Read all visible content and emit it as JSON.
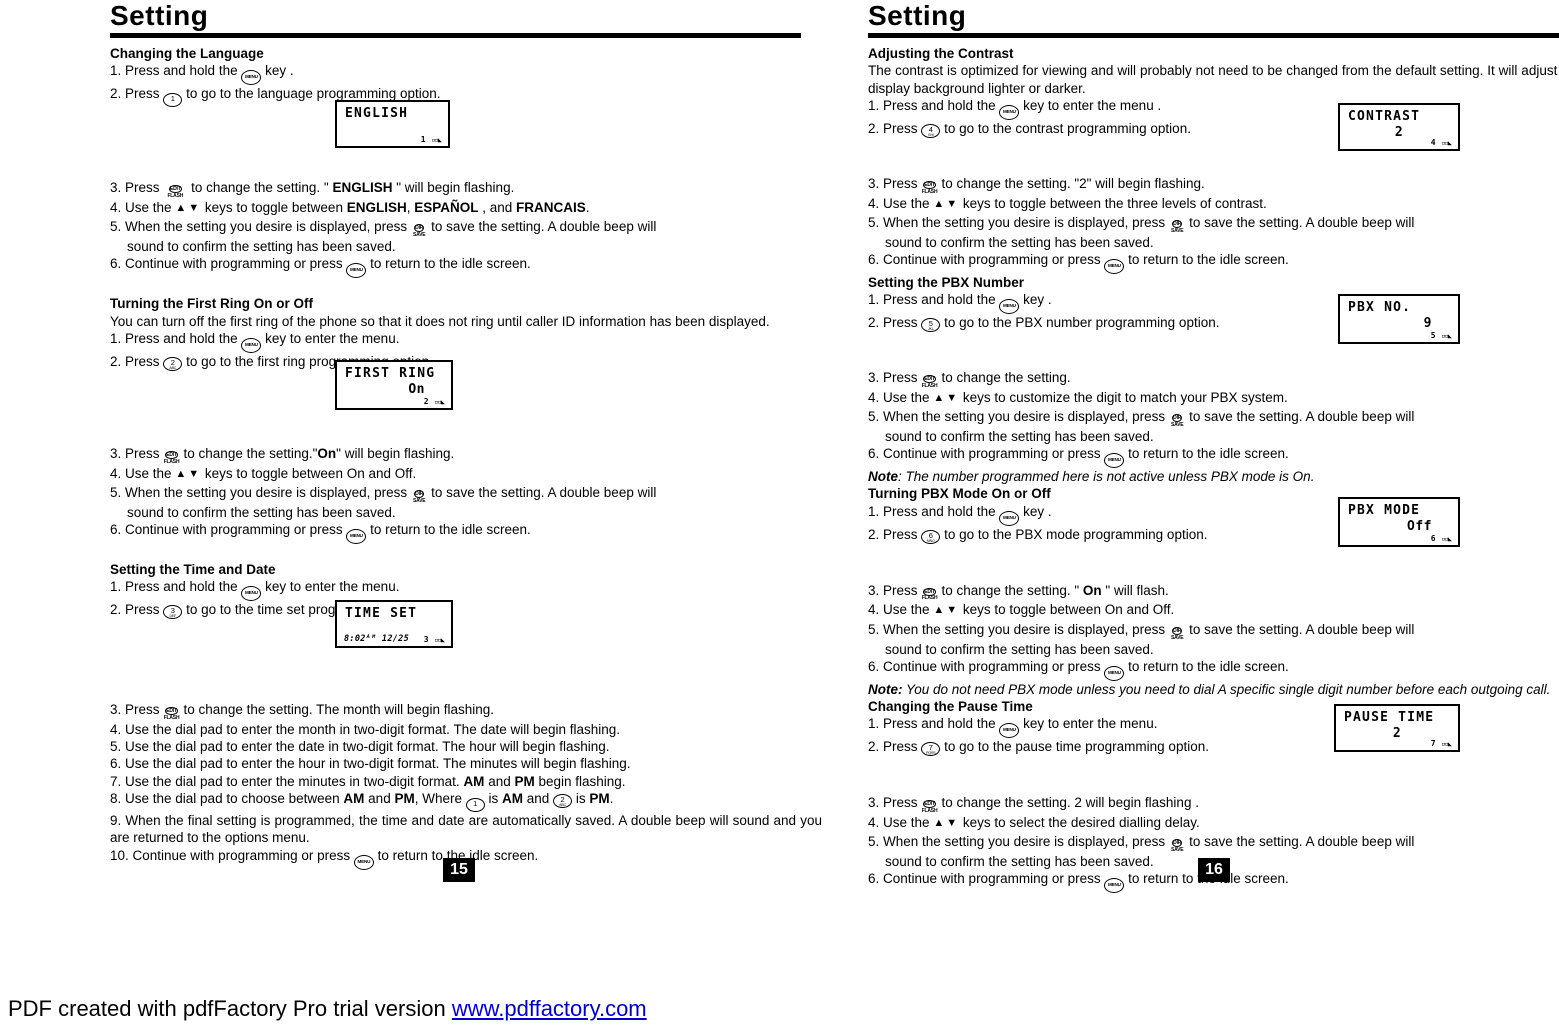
{
  "document": {
    "footer_text": "PDF created with pdfFactory Pro trial version ",
    "footer_link": "www.pdffactory.com"
  },
  "left_page": {
    "title": "Setting",
    "page_number": "15",
    "sections": [
      {
        "heading": "Changing the Language",
        "steps_before": [
          "1. Press and hold the",
          "2. Press"
        ],
        "step1_tail": "key .",
        "step2_tail": "to go to the language programming option.",
        "lcd": {
          "line1": "ENGLISH",
          "line2": "",
          "indicator": "1"
        },
        "steps_after": [
          {
            "num": "3. Press",
            "mid": "to change the setting. \" ",
            "bold": "ENGLISH",
            "tail": " \"  will begin flashing."
          },
          {
            "num": "4. Use the",
            "mid": "keys to toggle between ",
            "bold": "ENGLISH",
            "bold2": "ESPAÑOL",
            "bold3": "FRANCAIS",
            "tail": "."
          },
          {
            "num": "5. When the setting you desire is displayed, press",
            "tail": "to save the setting. A double beep will",
            "cont": "sound to confirm the setting has been saved."
          },
          {
            "num": "6. Continue with programming or press",
            "tail": "to return to the idle screen."
          }
        ]
      },
      {
        "heading": "Turning the First Ring On or Off",
        "intro": "You can turn off the first ring of the phone so that it does not ring until caller ID information has been displayed.",
        "step1": "1. Press and hold the",
        "step1_tail": "key to enter the menu.",
        "step2": "2. Press",
        "step2_tail": "to go to the first ring programming option.",
        "lcd": {
          "line1": "FIRST RING",
          "line2": "On",
          "indicator": "2"
        },
        "steps_after": [
          {
            "num": "3. Press",
            "mid": "to change the setting.\"",
            "bold": "On",
            "tail": "\" will begin flashing."
          },
          {
            "num": "4. Use the",
            "mid": "keys to toggle between On and Off.",
            "tail": ""
          },
          {
            "num": "5. When the setting you desire is displayed, press",
            "tail": "to save the setting. A double beep will",
            "cont": "sound to confirm the setting has been saved."
          },
          {
            "num": "6. Continue with programming or press",
            "tail": "to  return to the idle screen."
          }
        ]
      },
      {
        "heading": "Setting the Time and Date",
        "step1": "1.  Press and hold the",
        "step1_tail": "key to enter the menu.",
        "step2": "2.  Press",
        "step2_tail": "to go to the time set programming option.",
        "lcd": {
          "line1": "TIME SET",
          "time": "8:02ᴬᴹ 12/25",
          "indicator": "3"
        },
        "steps_after": [
          "3.  Press",
          "4.  Use the dial pad to enter the month in two-digit format. The date will begin flashing.",
          "5.  Use the dial pad to enter the date in two-digit format. The hour will begin flashing.",
          "6.  Use the dial pad to enter the hour in two-digit format.  The minutes will begin flashing.",
          "7.  Use the dial pad to enter the minutes in two-digit format. ",
          "8.  Use the dial pad to choose between ",
          "9.   When the final setting is programmed, the time and date are automatically saved. A double beep will sound and you are returned to the options menu.",
          "10. Continue with programming or press"
        ],
        "step3_tail": "to change the setting. The month will  begin flashing.",
        "step7_bold_am": "AM",
        "step7_mid": " and ",
        "step7_bold_pm": "PM",
        "step7_tail": " begin flashing.",
        "step8_bold_am": "AM",
        "step8_mid": " and ",
        "step8_bold_pm": "PM",
        "step8_where": ", Where",
        "step8_is_am": "is",
        "step8_am": "AM",
        "step8_and": "and",
        "step8_is2": "is",
        "step8_pm": "PM",
        "step8_period": ".",
        "step10_tail": "to return to the idle screen."
      }
    ]
  },
  "right_page": {
    "title": "Setting",
    "page_number": "16",
    "sections": [
      {
        "heading": "Adjusting the Contrast",
        "intro": "The contrast is optimized for viewing and will probably not need to be changed from the default setting. It will adjust the display background lighter or darker.",
        "step1": "1. Press and hold the",
        "step1_tail": "key to enter the menu .",
        "step2": "2. Press",
        "step2_tail": "to go to the contrast programming option.",
        "lcd": {
          "line1": "CONTRAST",
          "line2": "2",
          "indicator": "4"
        },
        "steps_after": [
          {
            "num": "3. Press",
            "tail": "to change the setting. \"2\" will begin flashing."
          },
          {
            "num": "4. Use the",
            "tail": "keys to toggle between the three levels of contrast."
          },
          {
            "num": "5. When the setting you desire is displayed, press",
            "tail": "to save the setting. A double beep will",
            "cont": "sound to confirm the setting has been saved."
          },
          {
            "num": "6. Continue with programming or press",
            "tail": "to return to the idle screen."
          }
        ]
      },
      {
        "heading": "Setting the PBX Number",
        "step1": "1. Press and hold the",
        "step1_tail": "key .",
        "step2": "2. Press",
        "step2_tail": "to go to the PBX number programming option.",
        "lcd": {
          "line1": "PBX NO.",
          "line2": "9",
          "indicator": "5"
        },
        "steps_after": [
          {
            "num": "3. Press",
            "tail": "to change the setting."
          },
          {
            "num": "4. Use the",
            "tail": "keys to customize the digit to match  your PBX system."
          },
          {
            "num": "5. When the setting you desire is displayed, press",
            "tail": "to  save the setting. A double beep will",
            "cont": "sound to confirm the setting has been saved."
          },
          {
            "num": "6. Continue with programming or press",
            "tail": "to  return to the idle screen."
          }
        ],
        "note_label": "Note",
        "note_text": ": The number programmed here is not active unless PBX mode is On."
      },
      {
        "heading": "Turning PBX Mode On or Off",
        "step1": "1. Press and hold the",
        "step1_tail": "key .",
        "step2": "2. Press",
        "step2_tail": "to go to the PBX mode programming option.",
        "lcd": {
          "line1": "PBX MODE",
          "line2": "Off",
          "indicator": "6"
        },
        "steps_after": [
          {
            "num": "3. Press",
            "mid": "to change the setting.  \" ",
            "bold": "On",
            "tail": " \"   will flash."
          },
          {
            "num": "4. Use the",
            "tail": "keys to toggle between On and Off."
          },
          {
            "num": "5. When the setting you desire is displayed, press",
            "tail": "to  save the setting. A double beep will",
            "cont": "sound to confirm the setting has been saved."
          },
          {
            "num": "6. Continue with programming or press",
            "tail": "to  return to the idle screen."
          }
        ],
        "note_label": "Note:",
        "note_text": " You do not need PBX mode unless you need to dial A specific single digit number before each  outgoing call."
      },
      {
        "heading": "Changing the Pause Time",
        "step1": "1. Press and hold the",
        "step1_tail": "key to enter the menu.",
        "step2": "2. Press",
        "step2_tail": "to go to the pause time programming option.",
        "lcd": {
          "line1": "PAUSE TIME",
          "line2": "2",
          "indicator": "7"
        },
        "steps_after": [
          {
            "num": "3. Press",
            "tail": "to change the setting.  2  will begin  flashing ."
          },
          {
            "num": "4. Use the",
            "tail": "keys to select the desired dialling  delay."
          },
          {
            "num": "5. When the setting you desire is displayed, press",
            "tail": "to  save the setting. A double beep will",
            "cont": "sound to confirm the setting has been saved."
          },
          {
            "num": "6. Continue with programming or press",
            "tail": "to return to the idle screen."
          }
        ]
      }
    ]
  },
  "keys": {
    "menu": "MENU",
    "edit": "EDIT",
    "flash": "FLASH",
    "dir": "DIR",
    "save": "SAVE",
    "digit1": "1",
    "digit2": "2",
    "digit2_abc": "ABC",
    "digit3": "3",
    "digit3_def": "DEF",
    "digit4": "4",
    "digit4_ghi": "GHI",
    "digit5": "5",
    "digit5_jkl": "JKL",
    "digit6": "6",
    "digit6_mno": "MNO",
    "digit7": "7",
    "digit7_pqrs": "PQRS",
    "up_down": "▲▼"
  }
}
